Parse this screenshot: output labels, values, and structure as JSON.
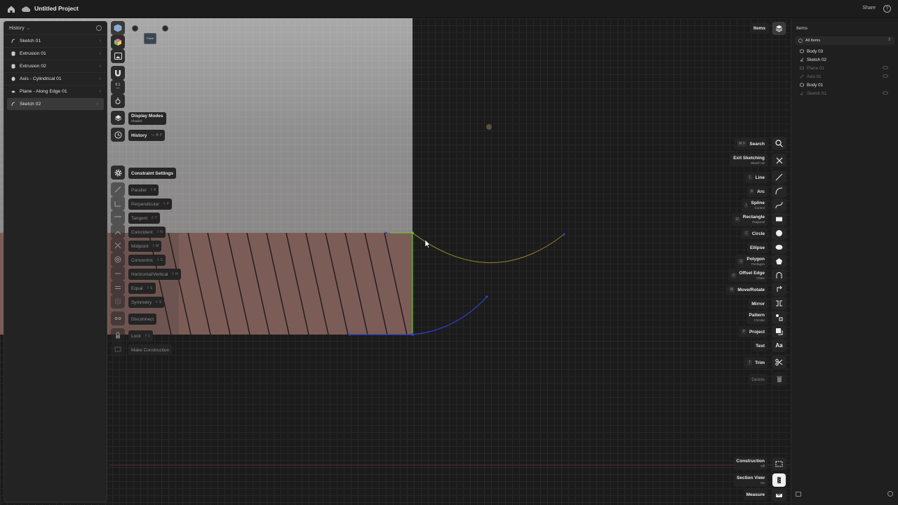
{
  "topbar": {
    "title": "Untitled Project",
    "share": "Share",
    "help": "?"
  },
  "history": {
    "header": "History",
    "items": [
      {
        "label": "Sketch 01"
      },
      {
        "label": "Extrusion 01"
      },
      {
        "label": "Extrusion 02"
      },
      {
        "label": "Axis - Cylindrical 01"
      },
      {
        "label": "Plane - Along Edge 01"
      },
      {
        "label": "Sketch 02"
      }
    ]
  },
  "viewcube": {
    "front_label": "Front"
  },
  "left_tools": {
    "display_modes": {
      "label": "Display Modes",
      "sub": "Shaded"
    },
    "history_tool": {
      "label": "History",
      "kbd": "⌥ ⌘ P"
    },
    "constraint_settings": {
      "label": "Constraint Settings"
    },
    "constraints": [
      {
        "label": "Parallel",
        "kbd": "⇧ A"
      },
      {
        "label": "Perpendicular",
        "kbd": "⇧ P"
      },
      {
        "label": "Tangent",
        "kbd": "⇧ T"
      },
      {
        "label": "Coincident",
        "kbd": "⇧ N"
      },
      {
        "label": "Midpoint",
        "kbd": "⇧ M"
      },
      {
        "label": "Concentric",
        "kbd": "⇧ C"
      },
      {
        "label": "Horizontal/Vertical",
        "kbd": "⇧ H"
      },
      {
        "label": "Equal",
        "kbd": "⇧ E"
      },
      {
        "label": "Symmetry",
        "kbd": "⇧ S"
      },
      {
        "label": "Disconnect",
        "kbd": ""
      },
      {
        "label": "Lock",
        "kbd": "⇧ L"
      },
      {
        "label": "Make Construction",
        "kbd": ""
      }
    ]
  },
  "right_tools": {
    "items_toggle": "Items",
    "search": {
      "label": "Search",
      "kbd": "⌘ F"
    },
    "exit_sketching": {
      "label": "Exit Sketching",
      "sub": "Sketch 02"
    },
    "line": {
      "label": "Line",
      "kbd": "L"
    },
    "arc": {
      "label": "Arc",
      "kbd": "A"
    },
    "spline": {
      "label": "Spline",
      "sub": "Control",
      "kbd": "I"
    },
    "rectangle": {
      "label": "Rectangle",
      "sub": "Diagonal",
      "kbd": "R"
    },
    "circle": {
      "label": "Circle",
      "kbd": "C"
    },
    "ellipse": {
      "label": "Ellipse"
    },
    "polygon": {
      "label": "Polygon",
      "sub": "Pentagon",
      "kbd": "G"
    },
    "offset_edge": {
      "label": "Offset Edge",
      "sub": "Chain",
      "kbd": "O"
    },
    "move_rotate": {
      "label": "Move/Rotate",
      "kbd": "M"
    },
    "mirror": {
      "label": "Mirror"
    },
    "pattern": {
      "label": "Pattern",
      "sub": "Circular"
    },
    "project": {
      "label": "Project",
      "kbd": "P"
    },
    "text": {
      "label": "Text"
    },
    "trim": {
      "label": "Trim",
      "kbd": "T"
    },
    "delete": {
      "label": "Delete"
    },
    "construction": {
      "label": "Construction",
      "sub": "Off"
    },
    "section_view": {
      "label": "Section View",
      "sub": "On"
    },
    "measure": {
      "label": "Measure"
    }
  },
  "items_panel": {
    "title": "Items",
    "filter": "All Items",
    "rows": [
      {
        "label": "Body 03",
        "visible": true
      },
      {
        "label": "Sketch 02",
        "visible": true
      },
      {
        "label": "Plane 01",
        "visible": false
      },
      {
        "label": "Axis 01",
        "visible": false
      },
      {
        "label": "Body 01",
        "visible": true
      },
      {
        "label": "Sketch 01",
        "visible": false
      }
    ]
  },
  "colors": {
    "accent_green": "#6bbf3a",
    "arc_blue": "#2f3fcf",
    "arc_olive": "#8a7a2a",
    "section_pink": "#7c5c57"
  }
}
